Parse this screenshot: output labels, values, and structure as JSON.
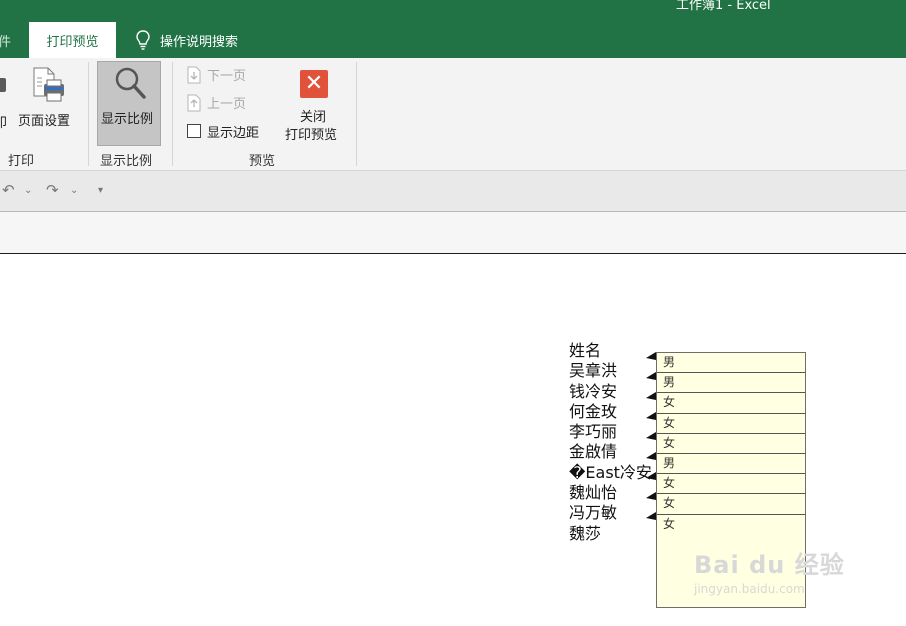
{
  "window": {
    "title": "工作簿1  -  Excel"
  },
  "tabs": {
    "file": "件",
    "active": "打印预览",
    "search": "操作说明搜索"
  },
  "ribbon": {
    "print_label": "印",
    "page_setup_label": "页面设置",
    "zoom_label": "显示比例",
    "next_page_label": "下一页",
    "prev_page_label": "上一页",
    "show_margins_label": "显示边距",
    "show_margins_checked": false,
    "close_line1": "关闭",
    "close_line2": "打印预览",
    "groups": {
      "print": "打印",
      "zoom": "显示比例",
      "preview": "预览"
    }
  },
  "sheet": {
    "names": [
      "姓名",
      "吴章洪",
      "钱冷安",
      "何金玫",
      "李巧丽",
      "金啟倩",
      "�East冷安",
      "魏灿怡",
      "冯万敏",
      "魏莎"
    ],
    "comments": [
      "男",
      "男",
      "女",
      "女",
      "女",
      "男",
      "女",
      "女",
      "女"
    ]
  },
  "watermark": {
    "line1": "Bai du 经验",
    "line2": "jingyan.baidu.com"
  },
  "colors": {
    "brand": "#217346",
    "close_red": "#e0533a",
    "comment_bg": "#ffffe1"
  }
}
